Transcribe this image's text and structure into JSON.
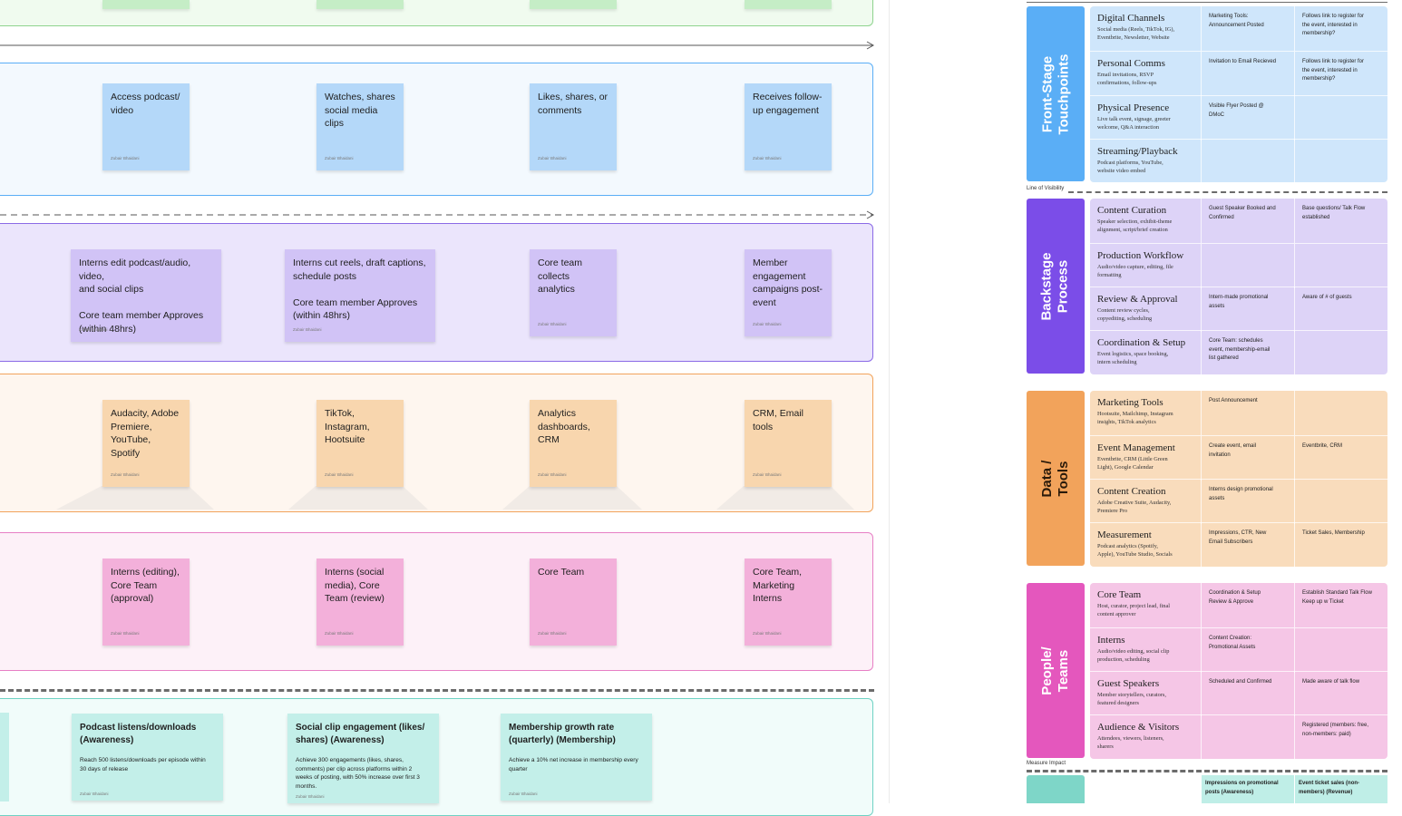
{
  "lanes": {
    "top_partial_stickies": [
      {
        "id": 1
      },
      {
        "id": 2
      },
      {
        "id": 3
      },
      {
        "id": 4
      }
    ],
    "frontstage": [
      {
        "text": "Access podcast/\nvideo",
        "author": "Zubair Bhaidani"
      },
      {
        "text": "Watches, shares\nsocial media clips",
        "author": "Zubair Bhaidani"
      },
      {
        "text": "Likes, shares, or\ncomments",
        "author": "Zubair Bhaidani"
      },
      {
        "text": "Receives follow-\nup engagement",
        "author": "Zubair Bhaidani"
      }
    ],
    "backstage": [
      {
        "text": "Interns edit podcast/audio, video,\nand social clips\n\nCore team  member Approves\n(within 48hrs)",
        "author": "Zubair Bhaidani"
      },
      {
        "text": "Interns cut reels, draft captions,\nschedule posts\n\nCore team  member Approves\n(within 48hrs)",
        "author": "Zubair Bhaidani"
      },
      {
        "text": "Core team\ncollects analytics",
        "author": "Zubair Bhaidani"
      },
      {
        "text": "Member\nengagement\ncampaigns post-\nevent",
        "author": "Zubair Bhaidani"
      }
    ],
    "tools": [
      {
        "text": "Audacity, Adobe\nPremiere,\nYouTube, Spotify",
        "author": "Zubair Bhaidani"
      },
      {
        "text": "TikTok,\nInstagram,\nHootsuite",
        "author": "Zubair Bhaidani"
      },
      {
        "text": "Analytics\ndashboards, CRM",
        "author": "Zubair Bhaidani"
      },
      {
        "text": "CRM, Email tools",
        "author": "Zubair Bhaidani"
      }
    ],
    "people": [
      {
        "text": "Interns (editing),\nCore Team\n(approval)",
        "author": "Zubair Bhaidani"
      },
      {
        "text": "Interns (social\nmedia), Core\nTeam (review)",
        "author": "Zubair Bhaidani"
      },
      {
        "text": "Core Team",
        "author": "Zubair Bhaidani"
      },
      {
        "text": "Core Team,\nMarketing Interns",
        "author": "Zubair Bhaidani"
      }
    ],
    "metrics": [
      {
        "title": "Podcast listens/downloads\n(Awareness)",
        "desc": "Reach 500 listens/downloads per episode within\n30 days of release",
        "author": "Zubair Bhaidani"
      },
      {
        "title": "Social clip engagement (likes/\nshares) (Awareness)",
        "desc": "Achieve 300 engagements (likes, shares,\ncomments) per clip across platforms within 2\nweeks of posting, with 50% increase over first 3\nmonths.",
        "author": "Zubair Bhaidani"
      },
      {
        "title": "Membership growth rate\n(quarterly) (Membership)",
        "desc": "Achieve a 10% net increase in membership every\nquarter",
        "author": "Zubair Bhaidani"
      }
    ]
  },
  "legend": {
    "line_of_visibility": "Line of Visibility",
    "measure_impact": "Measure Impact",
    "groups": [
      {
        "category": "Front-Stage\nTouchpoints",
        "color": "#5aaef6",
        "cell_color": "#cfe6fb",
        "rows": [
          {
            "title": "Digital Channels",
            "sub": "Social media (Reels, TikTok, IG),\nEventbrite, Newsletter, Website",
            "c2": "Marketing Tools:\nAnnouncement Posted",
            "c3": "Follows link to register for\nthe event, interested in\nmembership?"
          },
          {
            "title": "Personal Comms",
            "sub": "Email invitations, RSVP\nconfirmations, follow-ups",
            "c2": "Invitation to Email Recieved",
            "c3": "Follows link to register for\nthe event, interested in\nmembership?"
          },
          {
            "title": "Physical Presence",
            "sub": "Live talk event, signage, greeter\nwelcome, Q&A interaction",
            "c2": "Visible Flyer Posted @\nDMoC",
            "c3": ""
          },
          {
            "title": "Streaming/Playback",
            "sub": "Podcast platforms, YouTube,\nwebsite video embed",
            "c2": "",
            "c3": ""
          }
        ]
      },
      {
        "category": "Backstage Process",
        "color": "#7b4de8",
        "cell_color": "#ddd3f7",
        "rows": [
          {
            "title": "Content Curation",
            "sub": "Speaker selection, exhibit-theme\nalignment, script/brief creation",
            "c2": "Guest Speaker Booked and\nConfirmed",
            "c3": "Base questions/ Talk Flow\nestablished"
          },
          {
            "title": "Production Workflow",
            "sub": "Audio/video capture, editing, file\nformatting",
            "c2": "",
            "c3": ""
          },
          {
            "title": "Review & Approval",
            "sub": "Content review cycles,\ncopyediting, scheduling",
            "c2": "Intern-made promotional\nassets",
            "c3": "Aware of # of guests"
          },
          {
            "title": "Coordination & Setup",
            "sub": "Event logistics, space booking,\nintern scheduling",
            "c2": "Core Team: schedules\nevent, membership-email\nlist gathered",
            "c3": ""
          }
        ]
      },
      {
        "category": "Data / Tools",
        "color": "#f2a35b",
        "cell_color": "#f9dcbc",
        "rows": [
          {
            "title": "Marketing Tools",
            "sub": "Hootsuite, Mailchimp, Instagram\ninsights, TikTok analytics",
            "c2": "Post Announcement",
            "c3": ""
          },
          {
            "title": "Event Management",
            "sub": "Eventbrite, CRM (Little Green\nLight), Google Calendar",
            "c2": "Create event, email\ninvitation",
            "c3": "Eventbrite, CRM"
          },
          {
            "title": "Content Creation",
            "sub": "Adobe Creative Suite, Audacity,\nPremiere Pro",
            "c2": "Interns design promotional\nassets",
            "c3": ""
          },
          {
            "title": "Measurement",
            "sub": "Podcast analytics (Spotify,\nApple), YouTube Studio, Socials",
            "c2": "Impressions, CTR, New\nEmail Subscribers",
            "c3": "Ticket Sales, Membership"
          }
        ]
      },
      {
        "category": "People/ Teams",
        "color": "#e457bd",
        "cell_color": "#f5c6e6",
        "rows": [
          {
            "title": "Core Team",
            "sub": "Host, curator, project lead, final\ncontent approver",
            "c2": "Coordination & Setup\nReview & Approve",
            "c3": "Establish Standard Talk Flow\nKeep up w Ticket"
          },
          {
            "title": "Interns",
            "sub": "Audio/video editing, social clip\nproduction, scheduling",
            "c2": "Content Creation:\nPromotional Assets",
            "c3": ""
          },
          {
            "title": "Guest Speakers",
            "sub": "Member storytellers, curators,\nfeatured designers",
            "c2": "Scheduled and Confirmed",
            "c3": "Made aware of talk flow"
          },
          {
            "title": "Audience & Visitors",
            "sub": "Attendees, viewers, listeners,\nsharers",
            "c2": "",
            "c3": "Registered (members: free,\nnon-members: paid)"
          }
        ]
      }
    ],
    "impact_cells": [
      "Impressions on promotional\nposts (Awareness)",
      "Event ticket sales (non-\nmembers) (Revenue)"
    ]
  }
}
